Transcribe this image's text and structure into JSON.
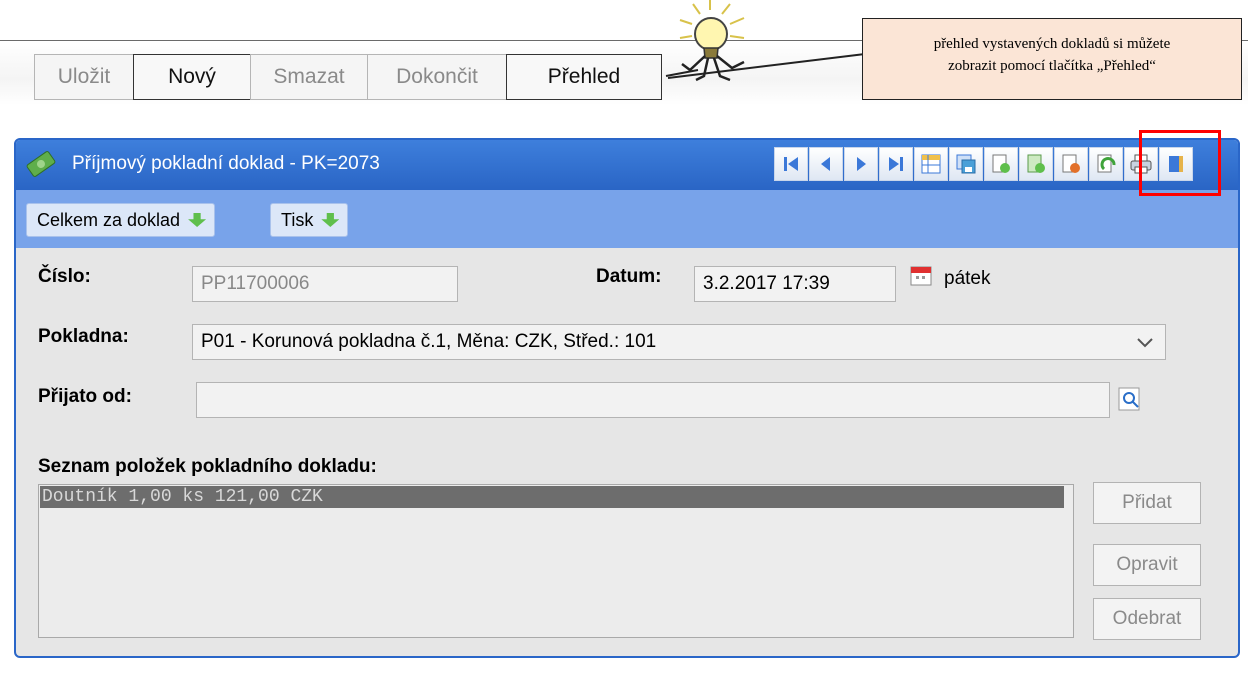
{
  "top_toolbar": {
    "buttons": [
      {
        "label": "Uložit"
      },
      {
        "label": "Nový"
      },
      {
        "label": "Smazat"
      },
      {
        "label": "Dokončit"
      },
      {
        "label": "Přehled"
      }
    ]
  },
  "callout": {
    "line1": "přehled vystavených dokladů si můžete",
    "line2": "zobrazit pomocí tlačítka „Přehled“"
  },
  "window": {
    "title": "Příjmový pokladní doklad - PK=2073",
    "icon": "money-icon",
    "nav_icons": [
      "first-record-icon",
      "prev-record-icon",
      "next-record-icon",
      "last-record-icon",
      "table-icon",
      "save-icon",
      "add-icon",
      "add-green-icon",
      "delete-icon",
      "refresh-icon",
      "print-icon",
      "exit-icon"
    ]
  },
  "subbar": {
    "total_label": "Celkem za doklad",
    "print_label": "Tisk"
  },
  "form": {
    "cislo_label": "Číslo:",
    "cislo_value": "PP11700006",
    "datum_label": "Datum:",
    "datum_value": "3.2.2017 17:39",
    "day_name": "pátek",
    "pokladna_label": "Pokladna:",
    "pokladna_value": "P01 - Korunová pokladna č.1, Měna: CZK, Střed.: 101",
    "prijato_label": "Přijato od:",
    "prijato_value": "",
    "list_label": "Seznam položek pokladního dokladu:",
    "items": [
      "Doutník 1,00 ks 121,00 CZK"
    ]
  },
  "side_buttons": {
    "add": "Přidat",
    "edit": "Opravit",
    "remove": "Odebrat"
  }
}
